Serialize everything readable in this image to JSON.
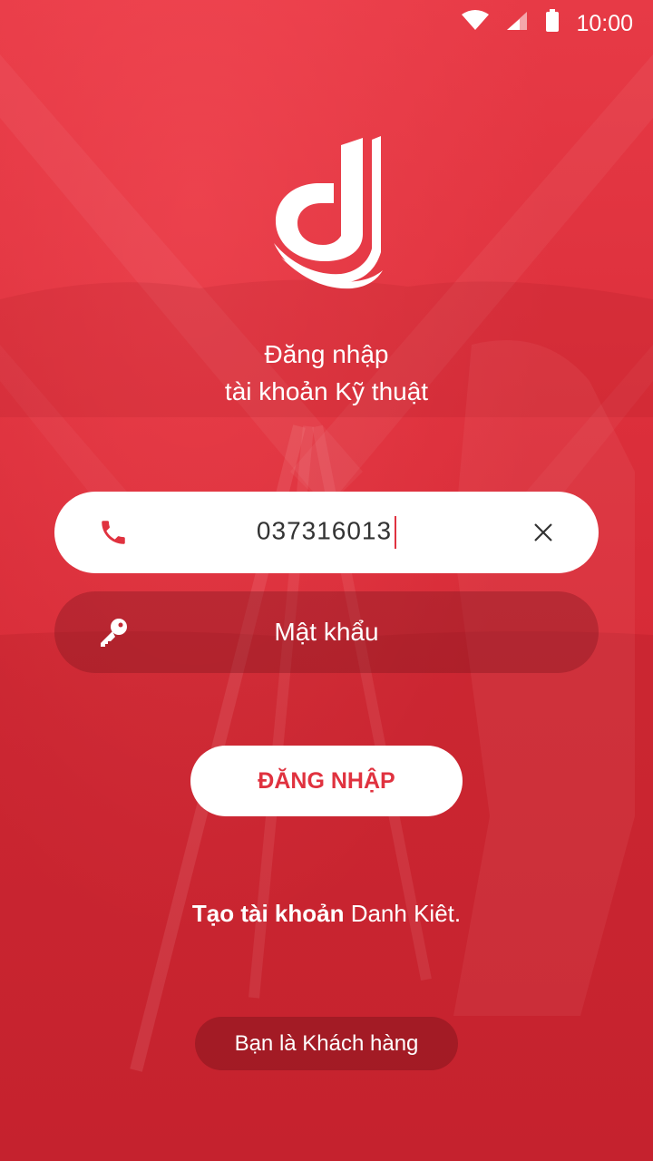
{
  "status_bar": {
    "time": "10:00"
  },
  "header": {
    "title_line1": "Đăng nhập",
    "title_line2": "tài khoản Kỹ thuật"
  },
  "phone_field": {
    "value": "037316013",
    "icon": "phone-icon",
    "clear_icon": "close-icon"
  },
  "password_field": {
    "placeholder": "Mật khẩu",
    "icon": "key-icon"
  },
  "login_button": {
    "label": "ĐĂNG NHẬP"
  },
  "signup": {
    "bold": "Tạo tài khoản",
    "rest": " Danh Kiêt."
  },
  "customer_button": {
    "label": "Bạn là Khách hàng"
  },
  "colors": {
    "accent": "#e0323f",
    "white": "#ffffff"
  }
}
